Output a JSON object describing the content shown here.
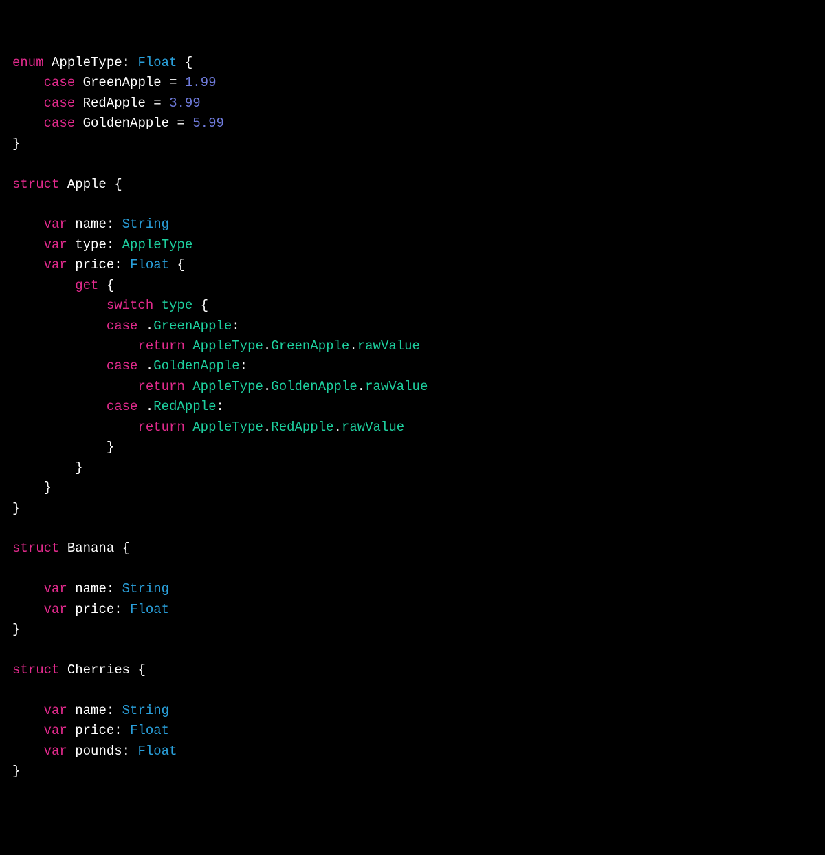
{
  "kw": {
    "enum": "enum",
    "struct": "struct",
    "case": "case",
    "var": "var",
    "get": "get",
    "switch": "switch",
    "return": "return"
  },
  "ty": {
    "Float": "Float",
    "String": "String",
    "AppleType": "AppleType"
  },
  "id": {
    "AppleType": "AppleType",
    "Apple": "Apple",
    "Banana": "Banana",
    "Cherries": "Cherries",
    "GreenApple": "GreenApple",
    "RedApple": "RedApple",
    "GoldenApple": "GoldenApple",
    "name": "name",
    "type": "type",
    "price": "price",
    "pounds": "pounds",
    "rawValue": "rawValue"
  },
  "num": {
    "p1": "1.99",
    "p2": "3.99",
    "p3": "5.99"
  }
}
